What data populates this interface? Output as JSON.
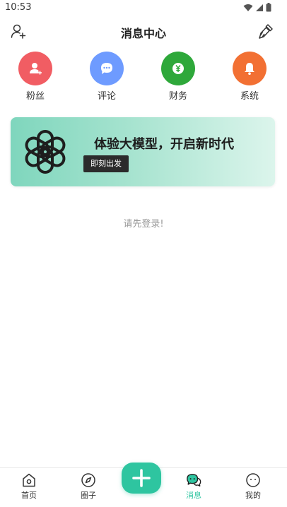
{
  "status_bar": {
    "time": "10:53"
  },
  "header": {
    "title": "消息中心"
  },
  "quick_actions": [
    {
      "label": "粉丝",
      "color": "#f15d63",
      "icon": "fans-icon"
    },
    {
      "label": "评论",
      "color": "#6e9bff",
      "icon": "comment-icon"
    },
    {
      "label": "财务",
      "color": "#2ea83a",
      "icon": "finance-icon"
    },
    {
      "label": "系统",
      "color": "#f27033",
      "icon": "bell-icon"
    }
  ],
  "banner": {
    "title": "体验大模型，开启新时代",
    "button": "即刻出发"
  },
  "login_hint": "请先登录!",
  "bottom_nav": {
    "items": [
      {
        "label": "首页",
        "icon": "home-icon"
      },
      {
        "label": "圈子",
        "icon": "compass-icon"
      },
      {
        "label": "消息",
        "icon": "message-icon",
        "active": true
      },
      {
        "label": "我的",
        "icon": "profile-icon"
      }
    ]
  },
  "colors": {
    "accent": "#2ec5a0"
  }
}
